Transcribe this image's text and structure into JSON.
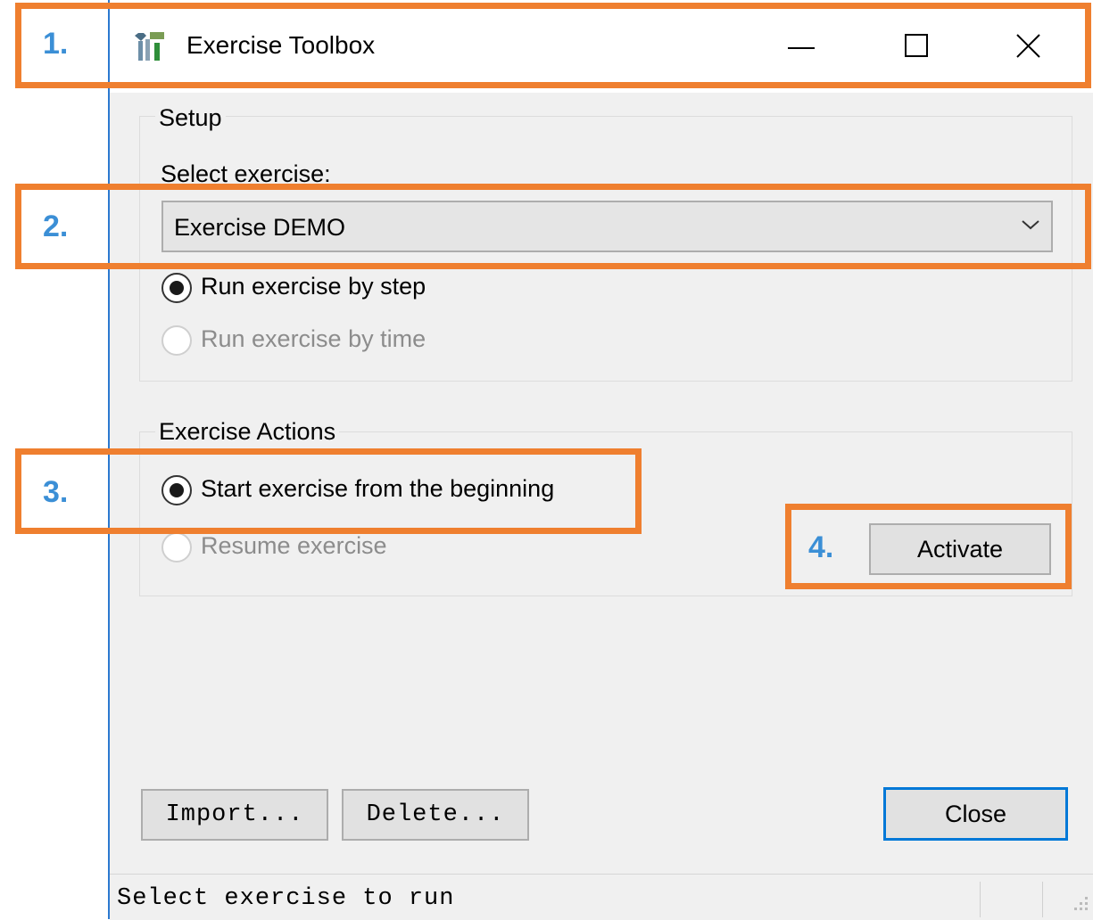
{
  "window": {
    "title": "Exercise Toolbox",
    "controls": {
      "minimize": "—",
      "maximize": "☐",
      "close": "✕"
    }
  },
  "setup": {
    "group_label": "Setup",
    "select_label": "Select exercise:",
    "selected_exercise": "Exercise DEMO",
    "run_by_step": "Run exercise by step",
    "run_by_time": "Run exercise by time"
  },
  "actions": {
    "group_label": "Exercise Actions",
    "start_from_beginning": "Start exercise from the beginning",
    "resume": "Resume exercise",
    "activate": "Activate"
  },
  "buttons": {
    "import": "Import...",
    "delete": "Delete...",
    "close": "Close"
  },
  "status": {
    "text": "Select exercise to run"
  },
  "annotations": {
    "n1": "1.",
    "n2": "2.",
    "n3": "3.",
    "n4": "4."
  },
  "colors": {
    "annotation_border": "#ef7f2f",
    "annotation_number": "#3b8fd6",
    "default_button_border": "#0078d7"
  },
  "icons": {
    "app": "toolbox-tools-icon",
    "combo_arrow": "chevron-down-icon",
    "grip": "resize-grip-icon"
  }
}
